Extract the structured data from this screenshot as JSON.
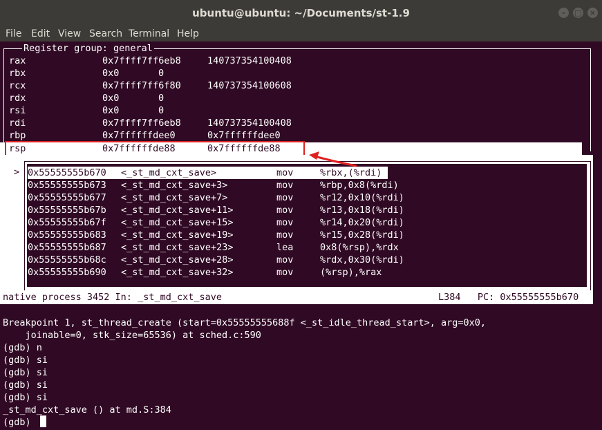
{
  "window": {
    "title": "ubuntu@ubuntu: ~/Documents/st-1.9"
  },
  "menu": [
    "File",
    "Edit",
    "View",
    "Search",
    "Terminal",
    "Help"
  ],
  "registers": {
    "group_title": "Register group: general",
    "rows": [
      {
        "name": "rax",
        "hex": "0x7ffff7ff6eb8",
        "dec": "140737354100408"
      },
      {
        "name": "rbx",
        "hex": "0x0",
        "dec": "0"
      },
      {
        "name": "rcx",
        "hex": "0x7ffff7ff6f80",
        "dec": "140737354100608"
      },
      {
        "name": "rdx",
        "hex": "0x0",
        "dec": "0"
      },
      {
        "name": "rsi",
        "hex": "0x0",
        "dec": "0"
      },
      {
        "name": "rdi",
        "hex": "0x7ffff7ff6eb8",
        "dec": "140737354100408"
      },
      {
        "name": "rbp",
        "hex": "0x7ffffffdee0",
        "dec": "0x7ffffffdee0"
      }
    ],
    "rsp": {
      "name": "rsp",
      "hex": "0x7ffffffde88",
      "dec": "0x7ffffffde88"
    }
  },
  "asm": {
    "current_marker": ">",
    "rows": [
      {
        "addr": "0x55555555b670",
        "sym": "<_st_md_cxt_save>",
        "op": "mov",
        "args": "%rbx,(%rdi)"
      },
      {
        "addr": "0x55555555b673",
        "sym": "<_st_md_cxt_save+3>",
        "op": "mov",
        "args": "%rbp,0x8(%rdi)"
      },
      {
        "addr": "0x55555555b677",
        "sym": "<_st_md_cxt_save+7>",
        "op": "mov",
        "args": "%r12,0x10(%rdi)"
      },
      {
        "addr": "0x55555555b67b",
        "sym": "<_st_md_cxt_save+11>",
        "op": "mov",
        "args": "%r13,0x18(%rdi)"
      },
      {
        "addr": "0x55555555b67f",
        "sym": "<_st_md_cxt_save+15>",
        "op": "mov",
        "args": "%r14,0x20(%rdi)"
      },
      {
        "addr": "0x55555555b683",
        "sym": "<_st_md_cxt_save+19>",
        "op": "mov",
        "args": "%r15,0x28(%rdi)"
      },
      {
        "addr": "0x55555555b687",
        "sym": "<_st_md_cxt_save+23>",
        "op": "lea",
        "args": "0x8(%rsp),%rdx"
      },
      {
        "addr": "0x55555555b68c",
        "sym": "<_st_md_cxt_save+28>",
        "op": "mov",
        "args": "%rdx,0x30(%rdi)"
      },
      {
        "addr": "0x55555555b690",
        "sym": "<_st_md_cxt_save+32>",
        "op": "mov",
        "args": "(%rsp),%rax"
      }
    ]
  },
  "status": {
    "left": "native process 3452 In: _st_md_cxt_save",
    "right": "L384   PC: 0x55555555b670"
  },
  "console": [
    "Breakpoint 1, st_thread_create (start=0x55555555688f <_st_idle_thread_start>, arg=0x0,",
    "    joinable=0, stk_size=65536) at sched.c:590",
    "(gdb) n",
    "(gdb) si",
    "(gdb) si",
    "(gdb) si",
    "(gdb) si",
    "_st_md_cxt_save () at md.S:384",
    "(gdb) "
  ],
  "colors": {
    "terminal_bg": "#300a24",
    "terminal_fg": "#ffffff",
    "titlebar": "#3c3b37",
    "highlight": "#e02020"
  }
}
